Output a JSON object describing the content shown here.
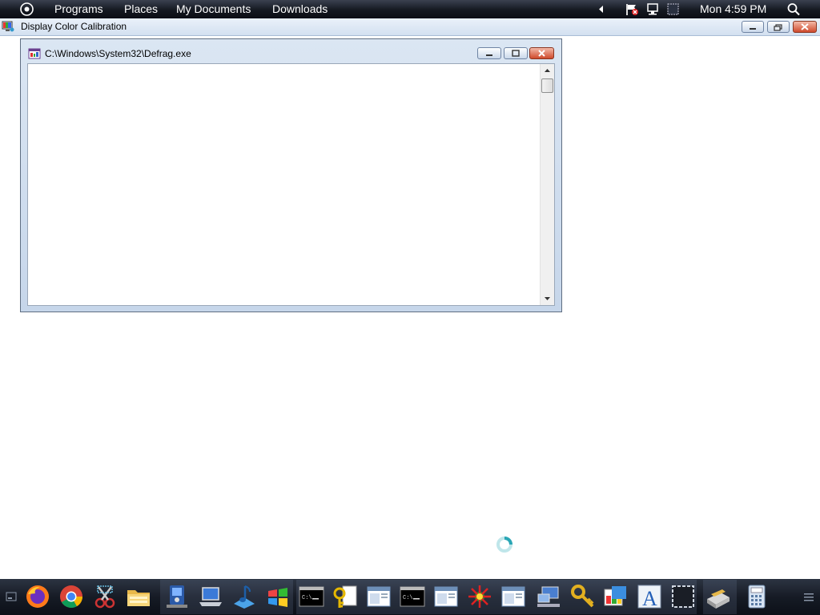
{
  "top_panel": {
    "menu_items": [
      "Programs",
      "Places",
      "My Documents",
      "Downloads"
    ],
    "clock": "Mon 4:59 PM"
  },
  "app_bar": {
    "title": "Display Color Calibration"
  },
  "window": {
    "title": "C:\\Windows\\System32\\Defrag.exe"
  },
  "dock": {
    "icons": [
      "firefox-icon",
      "chrome-icon",
      "snipping-tool-icon",
      "file-explorer-icon",
      "media-app-icon",
      "laptop-icon",
      "music-icon",
      "windows-flag-icon",
      "command-prompt-icon",
      "key-settings-icon",
      "window-app-icon",
      "command-prompt-icon",
      "window-app-icon",
      "network-tool-icon",
      "window-app-icon",
      "computer-network-icon",
      "key-icon",
      "color-management-icon",
      "font-icon",
      "screen-capture-icon",
      "scanner-icon",
      "calculator-icon"
    ]
  },
  "colors": {
    "panel": "#141820",
    "titlebar": "#dbe6f3",
    "close_button": "#cf4a2c"
  }
}
